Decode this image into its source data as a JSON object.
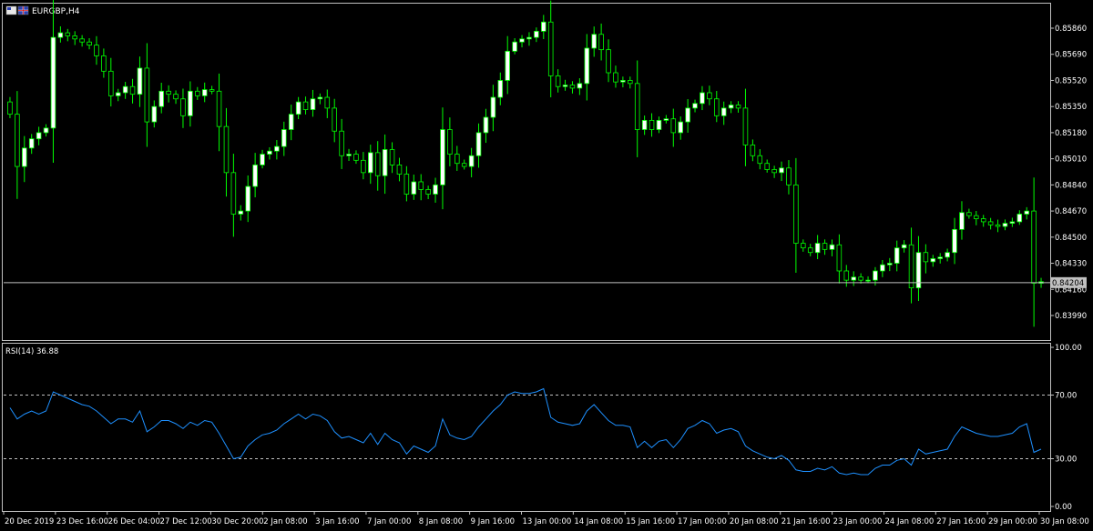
{
  "window": {
    "title": "EURGBP,H4"
  },
  "colors": {
    "background": "#000000",
    "grid_border": "#c0c0c0",
    "bull_body": "#ffffff",
    "bear_body": "#000000",
    "wick": "#00ff00",
    "rsi_line": "#1e90ff",
    "level_line": "#c0c0c0",
    "price_line": "#c0c0c0",
    "current_price_tag_bg": "#c0c0c0"
  },
  "chart_data": [
    {
      "type": "candlestick",
      "title": "EURGBP,H4",
      "y_ticks": [
        "0.85860",
        "0.85690",
        "0.85520",
        "0.85350",
        "0.85180",
        "0.85010",
        "0.84840",
        "0.84670",
        "0.84500",
        "0.84330",
        "0.84160",
        "0.83990"
      ],
      "ylim": [
        0.8392,
        0.8596
      ],
      "current_price": "0.84204",
      "x_tick_labels": [
        "20 Dec 2019",
        "23 Dec 16:00",
        "26 Dec 04:00",
        "27 Dec 12:00",
        "30 Dec 20:00",
        "2 Jan 08:00",
        "3 Jan 16:00",
        "7 Jan 00:00",
        "8 Jan 08:00",
        "9 Jan 16:00",
        "13 Jan 00:00",
        "14 Jan 08:00",
        "15 Jan 16:00",
        "17 Jan 00:00",
        "20 Jan 08:00",
        "21 Jan 16:00",
        "23 Jan 00:00",
        "24 Jan 08:00",
        "27 Jan 16:00",
        "29 Jan 00:00",
        "30 Jan 08:00"
      ],
      "close": [
        0.853,
        0.8496,
        0.8508,
        0.8514,
        0.8518,
        0.8521,
        0.858,
        0.8583,
        0.8581,
        0.8579,
        0.8577,
        0.8575,
        0.8568,
        0.8558,
        0.8542,
        0.8544,
        0.8548,
        0.8543,
        0.856,
        0.8525,
        0.8535,
        0.8545,
        0.8543,
        0.854,
        0.8529,
        0.8545,
        0.8542,
        0.8546,
        0.8545,
        0.8522,
        0.8492,
        0.8465,
        0.8467,
        0.8483,
        0.8497,
        0.8504,
        0.8506,
        0.8509,
        0.852,
        0.853,
        0.8538,
        0.8533,
        0.854,
        0.8541,
        0.8534,
        0.8519,
        0.8503,
        0.8504,
        0.85,
        0.8492,
        0.8505,
        0.849,
        0.8507,
        0.8497,
        0.8491,
        0.8478,
        0.8486,
        0.8481,
        0.8478,
        0.8484,
        0.852,
        0.8504,
        0.8498,
        0.8496,
        0.8503,
        0.8518,
        0.8528,
        0.8541,
        0.8552,
        0.8571,
        0.8577,
        0.8579,
        0.858,
        0.8584,
        0.859,
        0.8555,
        0.8548,
        0.8549,
        0.8547,
        0.855,
        0.8573,
        0.8582,
        0.8572,
        0.8557,
        0.8551,
        0.8552,
        0.855,
        0.852,
        0.8526,
        0.852,
        0.8526,
        0.8527,
        0.8518,
        0.8525,
        0.8534,
        0.8537,
        0.8544,
        0.854,
        0.8529,
        0.8534,
        0.8536,
        0.8534,
        0.851,
        0.8503,
        0.8498,
        0.8494,
        0.8492,
        0.8495,
        0.8484,
        0.8446,
        0.8443,
        0.844,
        0.8446,
        0.8442,
        0.8445,
        0.8428,
        0.8422,
        0.8424,
        0.8422,
        0.8422,
        0.8428,
        0.8432,
        0.8433,
        0.8443,
        0.8445,
        0.8417,
        0.844,
        0.8434,
        0.8436,
        0.8437,
        0.844,
        0.8455,
        0.8466,
        0.8464,
        0.8462,
        0.846,
        0.8458,
        0.8457,
        0.8459,
        0.846,
        0.8465,
        0.8467,
        0.842,
        0.8421
      ],
      "ohlc_series_length": 143,
      "rsi": {
        "label": "RSI(14) 36.88",
        "levels": [
          70,
          30
        ],
        "y_ticks": [
          "100.00",
          "70.00",
          "30.00",
          "0.00"
        ],
        "ylim": [
          0,
          100
        ],
        "values": [
          62,
          55,
          58,
          60,
          58,
          60,
          72,
          70,
          68,
          66,
          64,
          63,
          60,
          56,
          52,
          55,
          55,
          53,
          60,
          47,
          50,
          54,
          54,
          52,
          49,
          53,
          51,
          54,
          53,
          46,
          38,
          30,
          31,
          38,
          42,
          45,
          46,
          48,
          52,
          55,
          58,
          55,
          58,
          57,
          54,
          47,
          43,
          44,
          42,
          40,
          46,
          39,
          46,
          42,
          40,
          33,
          38,
          36,
          34,
          38,
          55,
          45,
          43,
          42,
          44,
          50,
          55,
          60,
          64,
          70,
          72,
          71,
          71,
          72,
          74,
          56,
          53,
          52,
          51,
          52,
          60,
          64,
          59,
          54,
          51,
          51,
          50,
          37,
          41,
          37,
          41,
          42,
          37,
          42,
          49,
          51,
          54,
          52,
          46,
          48,
          49,
          47,
          38,
          35,
          33,
          31,
          30,
          32,
          29,
          23,
          22,
          22,
          24,
          23,
          25,
          21,
          20,
          21,
          20,
          20,
          24,
          26,
          26,
          29,
          30,
          26,
          36,
          33,
          34,
          35,
          36,
          44,
          50,
          48,
          46,
          45,
          44,
          44,
          45,
          46,
          50,
          52,
          34,
          36
        ]
      }
    }
  ]
}
